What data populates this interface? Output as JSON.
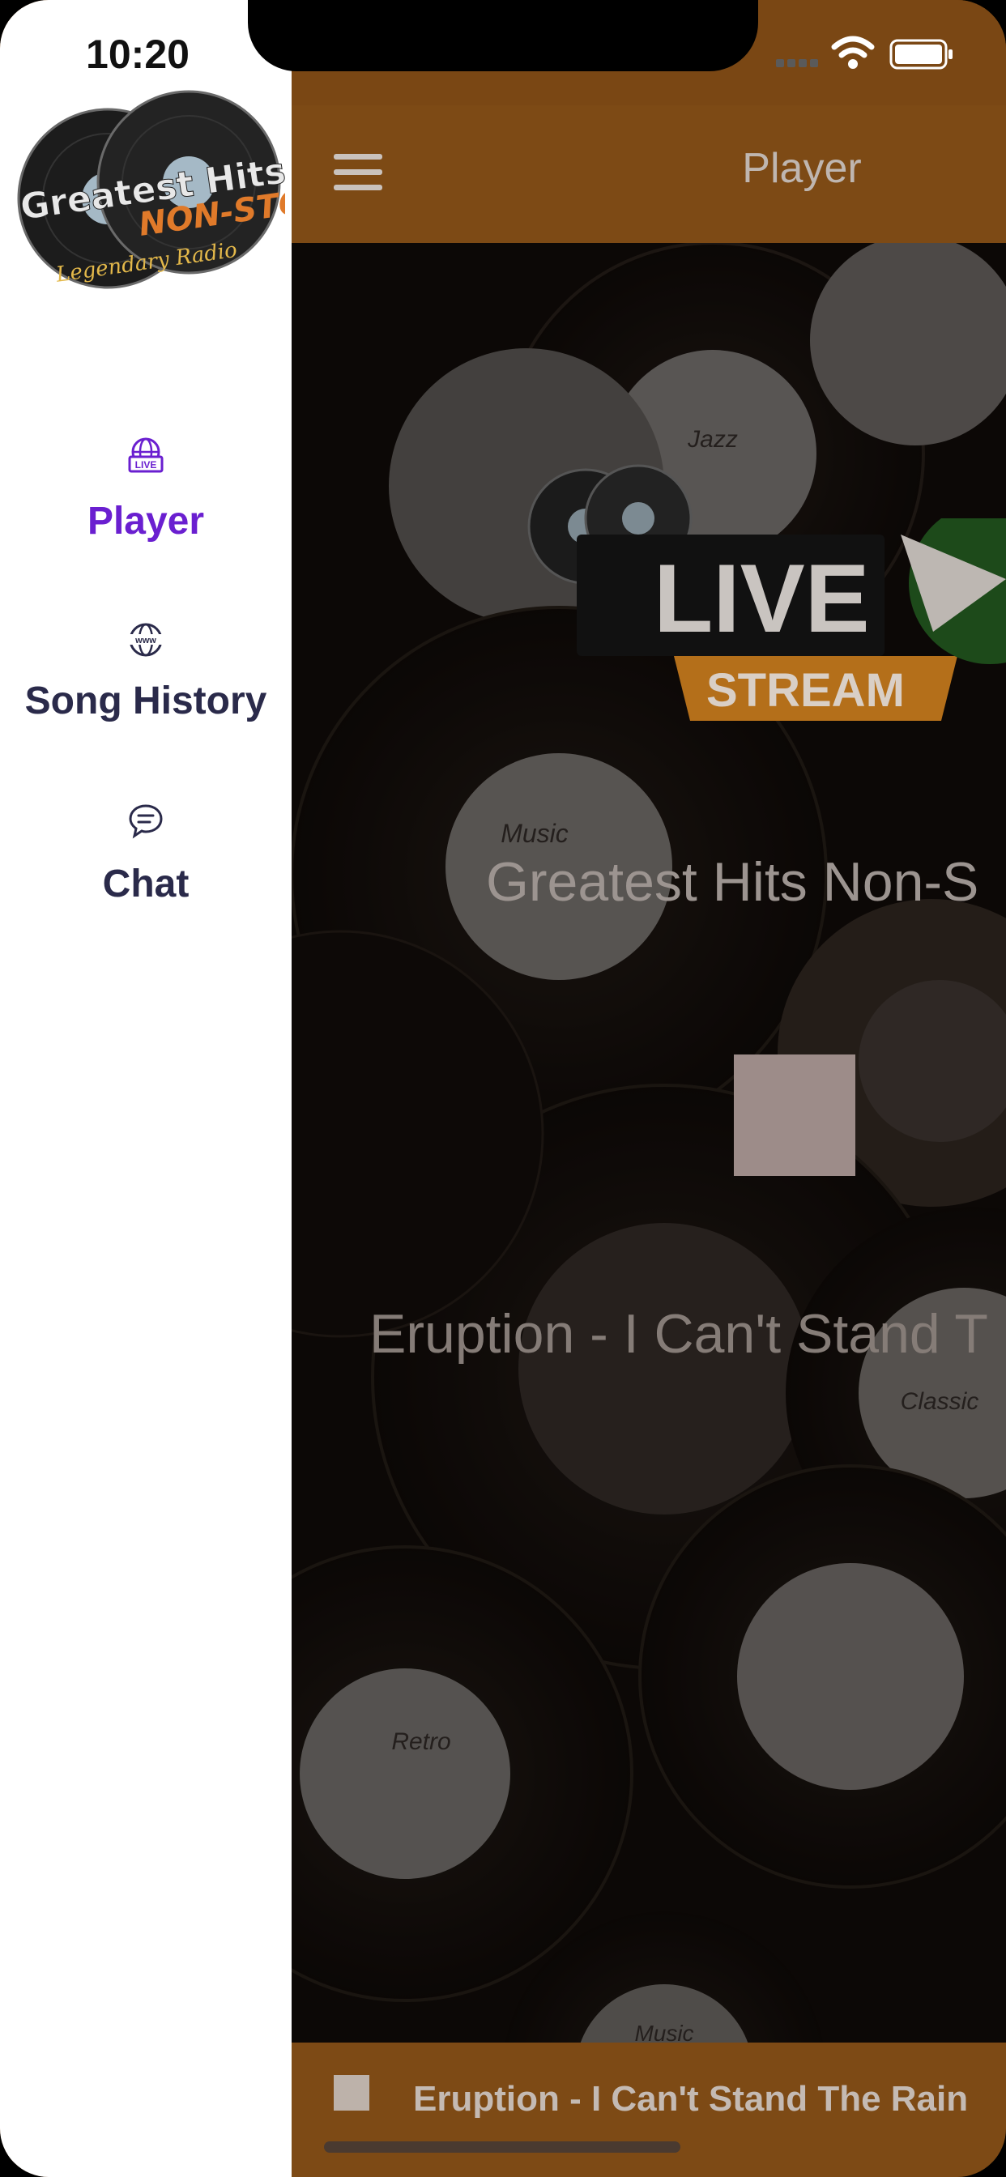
{
  "status_bar": {
    "time": "10:20"
  },
  "navbar": {
    "title": "Player",
    "menu_icon": "hamburger-icon"
  },
  "player": {
    "badge_text_top": "LIVE",
    "badge_text_bottom": "STREAM",
    "station_name": "Greatest Hits Non-S",
    "now_playing": "Eruption - I Can't Stand T",
    "stop_icon": "stop-icon"
  },
  "mini_player": {
    "now_playing": "Eruption - I Can't Stand The Rain",
    "stop_icon": "stop-icon"
  },
  "drawer": {
    "logo": {
      "line1": "Greatest Hits",
      "line2": "NON-STOP",
      "line3": "Legendary Radio"
    },
    "items": [
      {
        "label": "Player",
        "icon": "live-globe-icon",
        "active": true
      },
      {
        "label": "Song History",
        "icon": "www-globe-icon",
        "active": false
      },
      {
        "label": "Chat",
        "icon": "chat-bubble-icon",
        "active": false
      }
    ]
  },
  "colors": {
    "accent": "#6a1fd0",
    "drawer_text": "#2a2a4a",
    "navbar": "#7d4a15",
    "badge_orange": "#c47a1e"
  },
  "vinyl_labels": [
    "Jazz",
    "Music",
    "Classic",
    "Retro",
    "Music"
  ]
}
